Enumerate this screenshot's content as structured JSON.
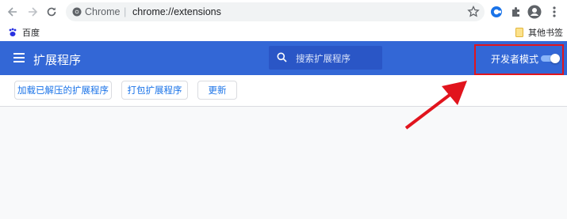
{
  "toolbar": {
    "site_name": "Chrome",
    "separator": "|",
    "url": "chrome://extensions"
  },
  "bookmarks": {
    "left_item": "百度",
    "right_folder": "其他书签"
  },
  "extensions_page": {
    "title": "扩展程序",
    "search_placeholder": "搜索扩展程序",
    "developer_mode_label": "开发者模式",
    "developer_mode_on": true
  },
  "actions": {
    "load_unpacked": "加载已解压的扩展程序",
    "pack_extension": "打包扩展程序",
    "update": "更新"
  },
  "colors": {
    "header_blue": "#3367d6",
    "search_bg": "#2a56c6",
    "accent_link": "#1a73e8",
    "annotation_red": "#e1141d"
  },
  "icons": {
    "back": "arrow-left-icon",
    "forward": "arrow-right-icon",
    "reload": "reload-icon",
    "site": "chrome-logo-icon",
    "bookmark_star": "star-icon",
    "profile_ext": "blue-circle-extension-icon",
    "extensions": "puzzle-icon",
    "account": "account-circle-icon",
    "menu": "vertical-dots-icon",
    "baidu": "baidu-paw-icon",
    "folder": "folder-icon",
    "hamburger": "hamburger-menu-icon",
    "search": "search-icon"
  }
}
